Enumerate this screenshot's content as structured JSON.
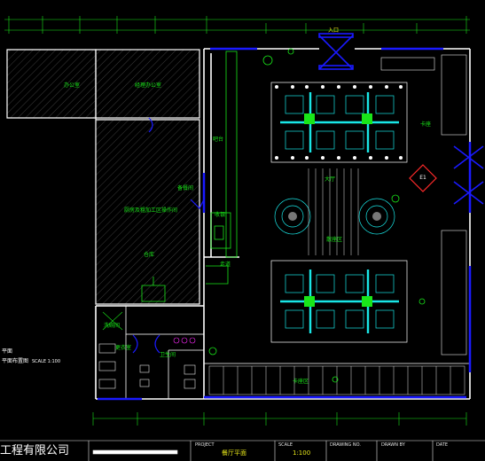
{
  "rooms": {
    "top_left": "办公室",
    "top_center": "经理办公室",
    "kitchen": "厨房及粗加工区操作间",
    "storage": "仓库",
    "store_mid": "备餐间",
    "wash": "洗碗间",
    "washroom_l": "卫生间",
    "washroom_r": "更衣室",
    "bar": "吧台",
    "corridor": "走道",
    "cashier": "收银",
    "entrance": "入口",
    "dining": "大厅",
    "dining_mid": "散座区",
    "booth_right": "卡座",
    "bottom_booths": "卡座区"
  },
  "marker": "E1",
  "side_notes": {
    "a": "平面",
    "b": "平面布置图",
    "c": "SCALE 1:100"
  },
  "title_block": {
    "company": "工程有限公司",
    "f1_label": "PROJECT",
    "f1_value": "餐厅平面",
    "f2_label": "SCALE",
    "f2_value": "1:100",
    "f3_label": "DRAWING NO.",
    "f4_label": "DRAWN BY",
    "f5_label": "DATE"
  },
  "colors": {
    "wall": "#ffffff",
    "furniture": "#19e6e6",
    "text": "#19e619",
    "window": "#1a1aff",
    "accent": "#ff2a2a"
  }
}
